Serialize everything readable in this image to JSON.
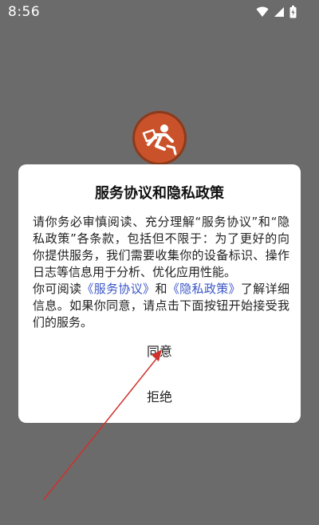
{
  "status_bar": {
    "time": "8:56",
    "icons": [
      "wifi-icon",
      "cellular-signal-icon",
      "battery-icon"
    ]
  },
  "app": {
    "logo_icon": "running-figure-logo",
    "logo_color": "#c9522a"
  },
  "dialog": {
    "title": "服务协议和隐私政策",
    "paragraph1": "请你务必审慎阅读、充分理解“服务协议”和“隐私政策”各条款，包括但不限于：为了更好的向你提供服务，我们需要收集你的设备标识、操作日志等信息用于分析、优化应用性能。",
    "paragraph2_prefix": "你可阅读",
    "service_link": "《服务协议》",
    "paragraph2_and": "和",
    "privacy_link": "《隐私政策》",
    "paragraph2_suffix": "了解详细信息。如果你同意，请点击下面按钮开始接受我们的服务。",
    "agree_label": "同意",
    "refuse_label": "拒绝",
    "link_color": "#3a55c8"
  },
  "annotation": {
    "arrow_color": "#d0312d"
  }
}
